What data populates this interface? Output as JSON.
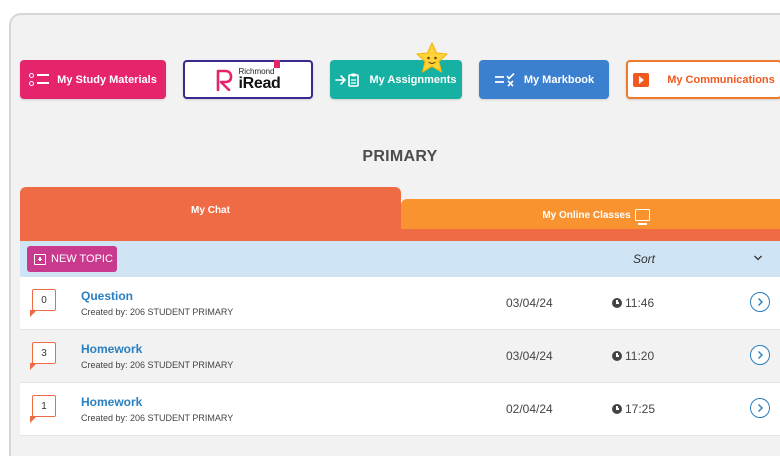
{
  "nav": {
    "study_materials": "My Study Materials",
    "iread": {
      "small": "Richmond",
      "big": "iRead"
    },
    "assignments": "My Assignments",
    "markbook": "My Markbook",
    "communications": "My Communications"
  },
  "page_title": "PRIMARY",
  "tabs": {
    "chat": "My Chat",
    "online_classes": "My Online Classes"
  },
  "toolbar": {
    "new_topic": "NEW TOPIC",
    "sort": "Sort"
  },
  "colors": {
    "study": "#e5246b",
    "assign": "#17b1a3",
    "markbook": "#3b7fcf",
    "comm": "#f05a20",
    "chat_tab": "#ef6b45",
    "online_tab": "#f99330",
    "link": "#2a7fc1"
  },
  "topics": [
    {
      "count": "0",
      "title": "Question",
      "created_by": "Created by: 206 STUDENT PRIMARY",
      "date": "03/04/24",
      "time": "11:46"
    },
    {
      "count": "3",
      "title": "Homework",
      "created_by": "Created by: 206 STUDENT PRIMARY",
      "date": "03/04/24",
      "time": "11:20"
    },
    {
      "count": "1",
      "title": "Homework",
      "created_by": "Created by: 206 STUDENT PRIMARY",
      "date": "02/04/24",
      "time": "17:25"
    }
  ]
}
